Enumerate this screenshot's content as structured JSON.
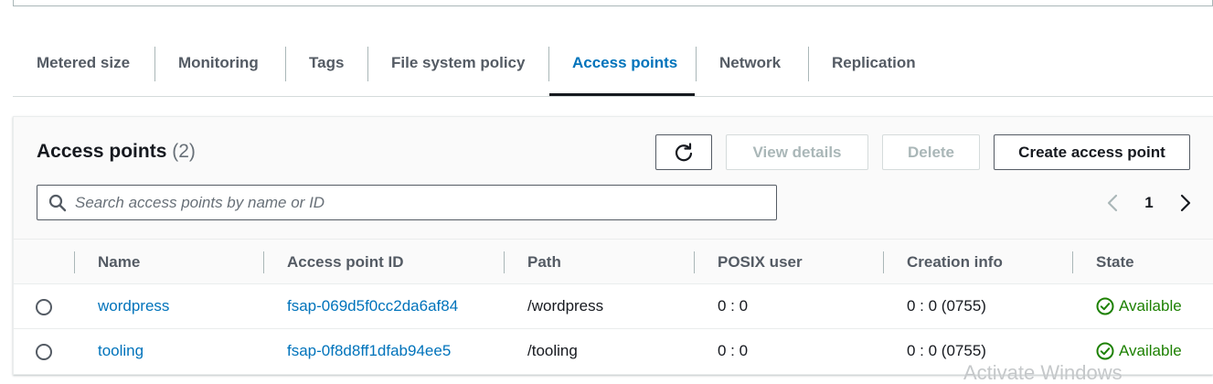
{
  "tabs": [
    {
      "label": "Metered size"
    },
    {
      "label": "Monitoring"
    },
    {
      "label": "Tags"
    },
    {
      "label": "File system policy"
    },
    {
      "label": "Access points",
      "active": true
    },
    {
      "label": "Network"
    },
    {
      "label": "Replication"
    }
  ],
  "panel": {
    "title": "Access points",
    "count": "(2)",
    "buttons": {
      "refresh_icon": "refresh-icon",
      "view_details": "View details",
      "delete": "Delete",
      "create": "Create access point"
    },
    "search": {
      "placeholder": "Search access points by name or ID",
      "value": ""
    },
    "pagination": {
      "current_page": "1"
    }
  },
  "table": {
    "columns": [
      "Name",
      "Access point ID",
      "Path",
      "POSIX user",
      "Creation info",
      "State"
    ],
    "rows": [
      {
        "name": "wordpress",
        "id": "fsap-069d5f0cc2da6af84",
        "path": "/wordpress",
        "posix_user": "0 : 0",
        "creation_info": "0 : 0 (0755)",
        "state": "Available"
      },
      {
        "name": "tooling",
        "id": "fsap-0f8d8ff1dfab94ee5",
        "path": "/tooling",
        "posix_user": "0 : 0",
        "creation_info": "0 : 0 (0755)",
        "state": "Available"
      }
    ]
  },
  "watermark": "Activate Windows",
  "colors": {
    "link": "#0073bb",
    "success": "#1d8102",
    "text": "#16191f",
    "muted": "#545b64"
  }
}
